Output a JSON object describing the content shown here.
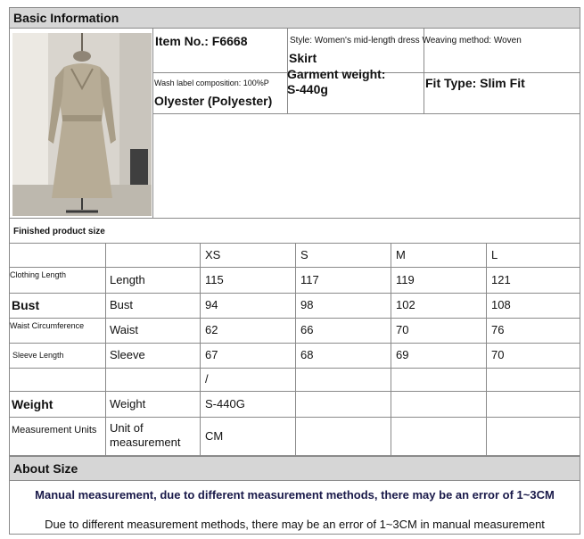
{
  "basic_info": {
    "title": "Basic Information",
    "item_no": "Item No.: F6668",
    "style_line1": "Style: Women's mid-length dress Weaving method: Woven",
    "style_line2": "Skirt",
    "wash_label_line1": "Wash label composition: 100%P",
    "wash_label_line2": "Olyester (Polyester)",
    "garment_weight_line1": "Garment weight:",
    "garment_weight_line2": "S-440g",
    "fit_type": "Fit Type: Slim Fit"
  },
  "finished_size": {
    "title": "Finished product size",
    "sizes": [
      "XS",
      "S",
      "M",
      "L"
    ],
    "rows": [
      {
        "label": "Clothing Length",
        "name": "Length",
        "values": [
          "115",
          "117",
          "119",
          "121"
        ]
      },
      {
        "label": "Bust",
        "name": "Bust",
        "values": [
          "94",
          "98",
          "102",
          "108"
        ]
      },
      {
        "label": "Waist Circumference",
        "name": "Waist",
        "values": [
          "62",
          "66",
          "70",
          "76"
        ]
      },
      {
        "label": "Sleeve Length",
        "name": "Sleeve",
        "values": [
          "67",
          "68",
          "69",
          "70"
        ]
      },
      {
        "label": "",
        "name": "",
        "values": [
          "/",
          "",
          "",
          ""
        ]
      },
      {
        "label": "Weight",
        "name": "Weight",
        "values": [
          "S-440G",
          "",
          "",
          ""
        ]
      },
      {
        "label": "Measurement Units",
        "name": "Unit of measurement",
        "values": [
          "CM",
          "",
          "",
          ""
        ]
      }
    ]
  },
  "about_size": {
    "title": "About Size",
    "note_bold": "Manual measurement, due to different measurement methods, there may be an error of 1~3CM",
    "note_plain": "Due to different measurement methods, there may be an error of 1~3CM in manual measurement"
  },
  "colors": {
    "header_bg": "#d6d6d6",
    "border": "#8a8a8a",
    "note_bold": "#1a1a4a"
  }
}
